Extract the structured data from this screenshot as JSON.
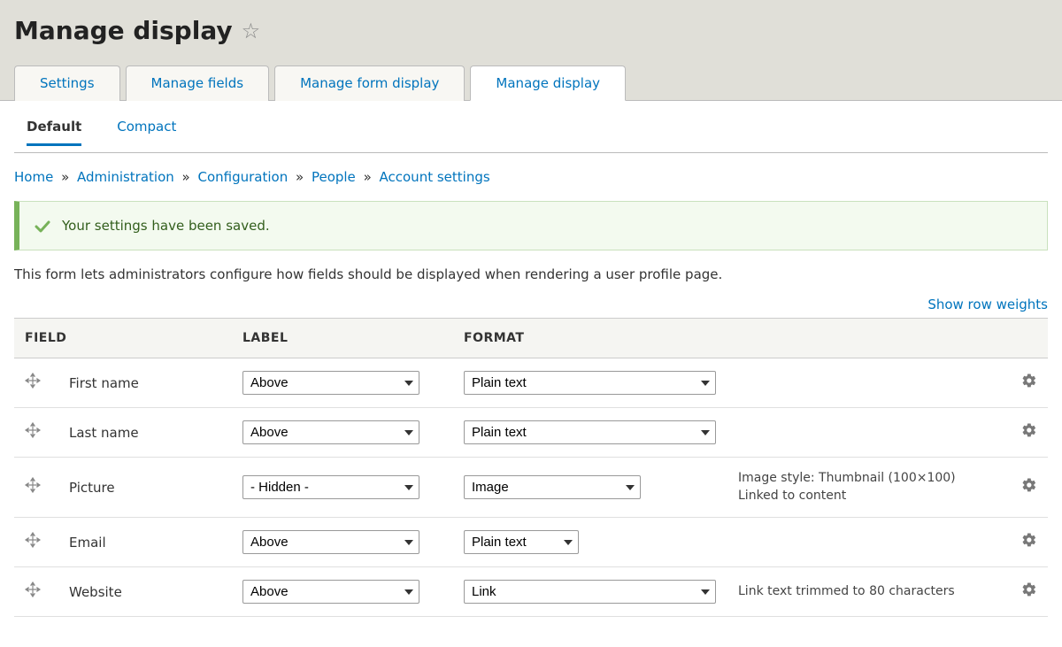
{
  "header": {
    "title": "Manage display"
  },
  "primary_tabs": [
    {
      "label": "Settings",
      "active": false
    },
    {
      "label": "Manage fields",
      "active": false
    },
    {
      "label": "Manage form display",
      "active": false
    },
    {
      "label": "Manage display",
      "active": true
    }
  ],
  "secondary_tabs": [
    {
      "label": "Default",
      "active": true
    },
    {
      "label": "Compact",
      "active": false
    }
  ],
  "breadcrumb": {
    "items": [
      "Home",
      "Administration",
      "Configuration",
      "People",
      "Account settings"
    ]
  },
  "status_message": "Your settings have been saved.",
  "description": "This form lets administrators configure how fields should be displayed when rendering a user profile page.",
  "row_weights_link": "Show row weights",
  "table": {
    "headers": {
      "field": "Field",
      "label": "Label",
      "format": "Format"
    },
    "rows": [
      {
        "field": "First name",
        "label": "Above",
        "format": "Plain text",
        "format_width": 285,
        "summary": ""
      },
      {
        "field": "Last name",
        "label": "Above",
        "format": "Plain text",
        "format_width": 285,
        "summary": ""
      },
      {
        "field": "Picture",
        "label": "- Hidden -",
        "format": "Image",
        "format_width": 200,
        "summary": "Image style: Thumbnail (100×100)\nLinked to content"
      },
      {
        "field": "Email",
        "label": "Above",
        "format": "Plain text",
        "format_width": 130,
        "summary": ""
      },
      {
        "field": "Website",
        "label": "Above",
        "format": "Link",
        "format_width": 285,
        "summary": "Link text trimmed to 80 characters"
      }
    ]
  }
}
